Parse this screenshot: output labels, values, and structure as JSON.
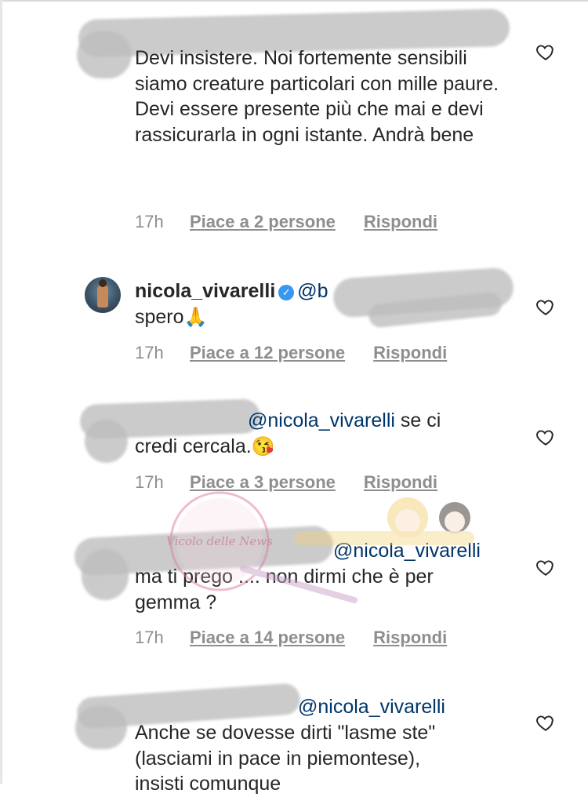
{
  "comments": [
    {
      "text": "Devi insistere. Noi fortemente sensibili siamo creature particolari con mille paure. Devi essere presente più che mai e devi rassicurarla in ogni istante. Andrà bene",
      "time": "17h",
      "likes": "Piace a 2 persone",
      "reply": "Rispondi"
    },
    {
      "username": "nicola_vivarelli",
      "mention_fragment": "@b",
      "text": "spero",
      "emoji": "🙏",
      "time": "17h",
      "likes": "Piace a 12 persone",
      "reply": "Rispondi"
    },
    {
      "mention": "@nicola_vivarelli",
      "text_line1": " se ci",
      "text_line2": "credi cercala.",
      "emoji": "😘",
      "time": "17h",
      "likes": "Piace a 3 persone",
      "reply": "Rispondi"
    },
    {
      "mention": "@nicola_vivarelli",
      "text": "ma ti prego .... non dirmi che è per gemma ?",
      "time": "17h",
      "likes": "Piace a 14 persone",
      "reply": "Rispondi"
    },
    {
      "mention": "@nicola_vivarelli",
      "text": "Anche se dovesse dirti \"lasme ste\" (lasciami in pace in piemontese), insisti comunque"
    }
  ],
  "watermark": {
    "brand_text": "Vicolo delle News"
  },
  "colors": {
    "text": "#262626",
    "meta": "#8e8e8e",
    "mention": "#003569",
    "verified": "#3897f0"
  }
}
